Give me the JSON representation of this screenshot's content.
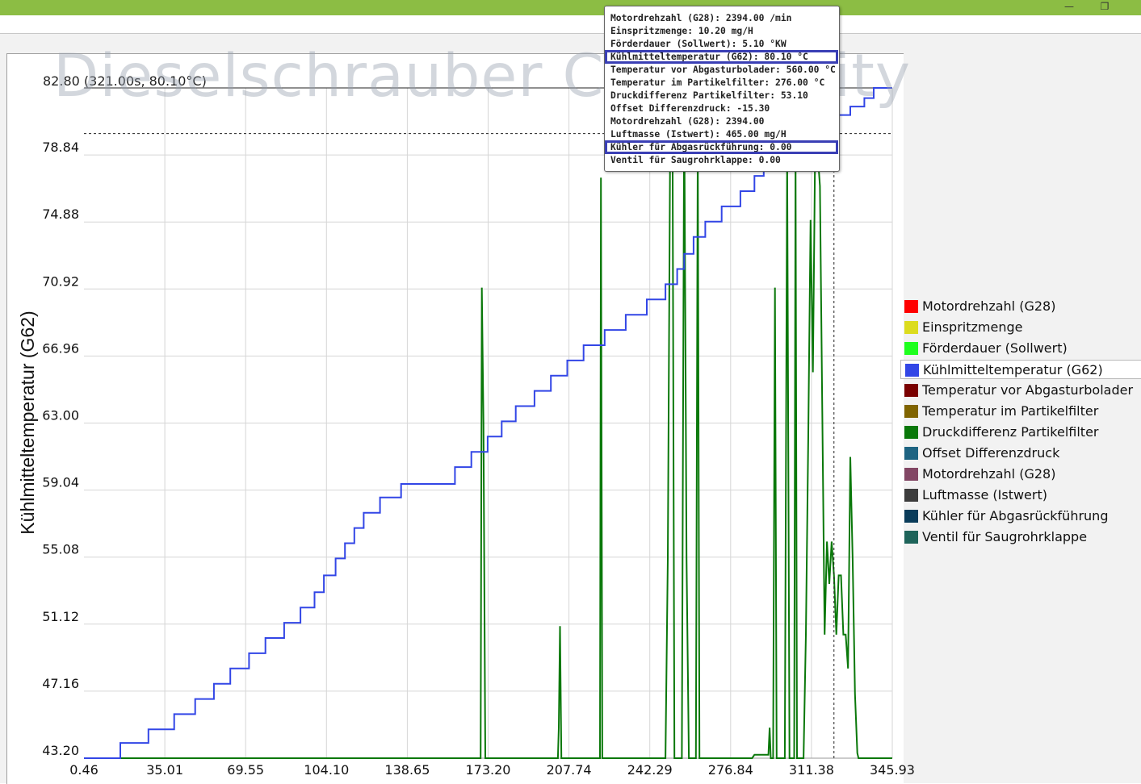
{
  "window": {
    "minimize_glyph": "—",
    "maximize_glyph": "❐"
  },
  "watermark": "Dieselschrauber Community",
  "cursor_readout": "82.80 (321.00s, 80.10°C)",
  "tooltip": {
    "lines": [
      "Motordrehzahl (G28): 2394.00  /min",
      "Einspritzmenge: 10.20  mg/H",
      "Förderdauer (Sollwert): 5.10 °KW",
      "Kühlmitteltemperatur (G62): 80.10 °C",
      "Temperatur vor Abgasturbolader: 560.00 °C",
      "Temperatur im Partikelfilter: 276.00 °C",
      "Druckdifferenz Partikelfilter: 53.10",
      "Offset Differenzdruck: -15.30",
      "Motordrehzahl (G28): 2394.00",
      "Luftmasse (Istwert): 465.00  mg/H",
      "Kühler für Abgasrückführung: 0.00",
      "Ventil für Saugrohrklappe: 0.00"
    ],
    "highlighted": [
      3,
      10
    ]
  },
  "legend": {
    "selected_index": 3,
    "items": [
      {
        "label": "Motordrehzahl (G28)",
        "color": "#ff0000"
      },
      {
        "label": "Einspritzmenge",
        "color": "#dcdc1e"
      },
      {
        "label": "Förderdauer (Sollwert)",
        "color": "#1eff1e"
      },
      {
        "label": "Kühlmitteltemperatur (G62)",
        "color": "#3246e6"
      },
      {
        "label": "Temperatur vor Abgasturbolader",
        "color": "#7a0000"
      },
      {
        "label": "Temperatur im Partikelfilter",
        "color": "#806400"
      },
      {
        "label": "Druckdifferenz Partikelfilter",
        "color": "#0a780a"
      },
      {
        "label": "Offset Differenzdruck",
        "color": "#1e6482"
      },
      {
        "label": "Motordrehzahl (G28)",
        "color": "#824664"
      },
      {
        "label": "Luftmasse (Istwert)",
        "color": "#3c3c3c"
      },
      {
        "label": "Kühler für Abgasrückführung",
        "color": "#0a3c5a"
      },
      {
        "label": "Ventil für Saugrohrklappe",
        "color": "#1e645a"
      }
    ]
  },
  "chart_data": {
    "type": "line",
    "ylabel": "Kühlmitteltemperatur (G62)",
    "xlabel": "",
    "xlim": [
      0.46,
      345.93
    ],
    "ylim": [
      43.2,
      82.8
    ],
    "x_ticks": [
      "0.46",
      "35.01",
      "69.55",
      "104.10",
      "138.65",
      "173.20",
      "207.74",
      "242.29",
      "276.84",
      "311.38",
      "345.93"
    ],
    "y_ticks": [
      "43.20",
      "47.16",
      "51.12",
      "55.08",
      "59.04",
      "63.00",
      "66.96",
      "70.92",
      "74.88",
      "78.84",
      "82.80"
    ],
    "cursor": {
      "x": 321.0,
      "y": 80.1
    },
    "grid": true,
    "series": [
      {
        "name": "Kühlmitteltemperatur (G62)",
        "color": "#3246e6",
        "points": [
          [
            0.46,
            43.2
          ],
          [
            16,
            43.2
          ],
          [
            16,
            44.1
          ],
          [
            28,
            44.1
          ],
          [
            28,
            44.9
          ],
          [
            39,
            44.9
          ],
          [
            39,
            45.8
          ],
          [
            48,
            45.8
          ],
          [
            48,
            46.7
          ],
          [
            56,
            46.7
          ],
          [
            56,
            47.6
          ],
          [
            63,
            47.6
          ],
          [
            63,
            48.5
          ],
          [
            71,
            48.5
          ],
          [
            71,
            49.4
          ],
          [
            78,
            49.4
          ],
          [
            78,
            50.3
          ],
          [
            86,
            50.3
          ],
          [
            86,
            51.2
          ],
          [
            93,
            51.2
          ],
          [
            93,
            52.1
          ],
          [
            99,
            52.1
          ],
          [
            99,
            53.0
          ],
          [
            103,
            53.0
          ],
          [
            103,
            54.0
          ],
          [
            108,
            54.0
          ],
          [
            108,
            55.0
          ],
          [
            112,
            55.0
          ],
          [
            112,
            55.9
          ],
          [
            116,
            55.9
          ],
          [
            116,
            56.8
          ],
          [
            120,
            56.8
          ],
          [
            120,
            57.7
          ],
          [
            127,
            57.7
          ],
          [
            127,
            58.6
          ],
          [
            136,
            58.6
          ],
          [
            136,
            59.4
          ],
          [
            159,
            59.4
          ],
          [
            159,
            60.4
          ],
          [
            166,
            60.4
          ],
          [
            166,
            61.3
          ],
          [
            173,
            61.3
          ],
          [
            173,
            62.2
          ],
          [
            179,
            62.2
          ],
          [
            179,
            63.1
          ],
          [
            185,
            63.1
          ],
          [
            185,
            64.0
          ],
          [
            193,
            64.0
          ],
          [
            193,
            64.9
          ],
          [
            200,
            64.9
          ],
          [
            200,
            65.8
          ],
          [
            207,
            65.8
          ],
          [
            207,
            66.7
          ],
          [
            214,
            66.7
          ],
          [
            214,
            67.6
          ],
          [
            223,
            67.6
          ],
          [
            223,
            68.5
          ],
          [
            232,
            68.5
          ],
          [
            232,
            69.4
          ],
          [
            241,
            69.4
          ],
          [
            241,
            70.3
          ],
          [
            249,
            70.3
          ],
          [
            249,
            71.2
          ],
          [
            254,
            71.2
          ],
          [
            254,
            72.1
          ],
          [
            257,
            72.1
          ],
          [
            257,
            73.0
          ],
          [
            261,
            73.0
          ],
          [
            261,
            74.0
          ],
          [
            266,
            74.0
          ],
          [
            266,
            74.9
          ],
          [
            273,
            74.9
          ],
          [
            273,
            75.8
          ],
          [
            281,
            75.8
          ],
          [
            281,
            76.7
          ],
          [
            287,
            76.7
          ],
          [
            287,
            77.6
          ],
          [
            291,
            77.6
          ],
          [
            291,
            78.5
          ],
          [
            297,
            78.5
          ],
          [
            297,
            79.4
          ],
          [
            304,
            79.4
          ],
          [
            304,
            80.1
          ],
          [
            313,
            80.1
          ],
          [
            313,
            80.8
          ],
          [
            321,
            80.8
          ],
          [
            321,
            81.2
          ],
          [
            328,
            81.2
          ],
          [
            328,
            81.7
          ],
          [
            334,
            81.7
          ],
          [
            334,
            82.2
          ],
          [
            338,
            82.2
          ],
          [
            338,
            82.8
          ],
          [
            345.93,
            82.8
          ]
        ]
      },
      {
        "name": "Druckdifferenz Partikelfilter",
        "color": "#0a780a",
        "points": [
          [
            0.46,
            43.2
          ],
          [
            170,
            43.2
          ],
          [
            170.5,
            71.0
          ],
          [
            171.2,
            63.0
          ],
          [
            172.0,
            43.2
          ],
          [
            203,
            43.2
          ],
          [
            203.4,
            45.0
          ],
          [
            203.9,
            51.0
          ],
          [
            204.5,
            43.2
          ],
          [
            221,
            43.2
          ],
          [
            221.4,
            77.5
          ],
          [
            222.0,
            43.2
          ],
          [
            249,
            43.2
          ],
          [
            250,
            55.0
          ],
          [
            251,
            79.5
          ],
          [
            252,
            81.0
          ],
          [
            252.8,
            43.2
          ],
          [
            256,
            43.2
          ],
          [
            257,
            82.0
          ],
          [
            258,
            55.0
          ],
          [
            259,
            43.2
          ],
          [
            262,
            43.2
          ],
          [
            262.8,
            80.0
          ],
          [
            263.5,
            43.2
          ],
          [
            286,
            43.2
          ],
          [
            287,
            43.4
          ],
          [
            293,
            43.4
          ],
          [
            293.5,
            45.0
          ],
          [
            294,
            43.2
          ],
          [
            295,
            43.2
          ],
          [
            295.8,
            71.0
          ],
          [
            296.5,
            43.2
          ],
          [
            300,
            43.2
          ],
          [
            301,
            79.0
          ],
          [
            302,
            43.2
          ],
          [
            304,
            43.2
          ],
          [
            304.6,
            79.0
          ],
          [
            305.2,
            43.2
          ],
          [
            308,
            43.2
          ],
          [
            309,
            50.5
          ],
          [
            310,
            62.0
          ],
          [
            311,
            75.0
          ],
          [
            312,
            66.0
          ],
          [
            313,
            80.0
          ],
          [
            314,
            79.0
          ],
          [
            315,
            77.0
          ],
          [
            317,
            50.5
          ],
          [
            318,
            56.0
          ],
          [
            319,
            53.5
          ],
          [
            320,
            56.0
          ],
          [
            321,
            54.0
          ],
          [
            322,
            50.5
          ],
          [
            323,
            54.0
          ],
          [
            324,
            54.0
          ],
          [
            325,
            50.5
          ],
          [
            326,
            50.5
          ],
          [
            327,
            48.5
          ],
          [
            328,
            61.0
          ],
          [
            329,
            55.0
          ],
          [
            330,
            47.0
          ],
          [
            331,
            43.5
          ],
          [
            331.5,
            43.2
          ],
          [
            345.93,
            43.2
          ]
        ]
      }
    ]
  }
}
